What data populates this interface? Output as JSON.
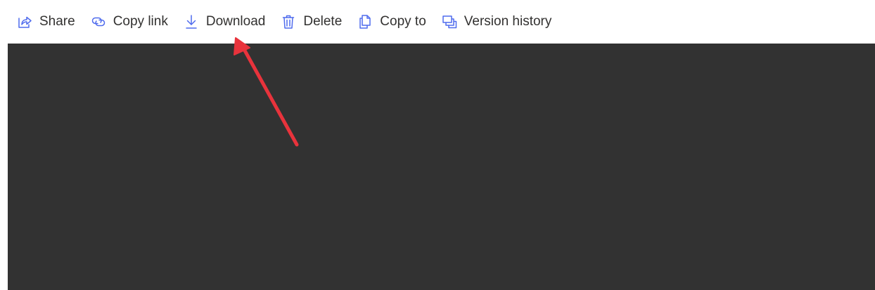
{
  "toolbar": {
    "items": [
      {
        "label": "Share",
        "icon": "share-icon"
      },
      {
        "label": "Copy link",
        "icon": "link-icon"
      },
      {
        "label": "Download",
        "icon": "download-icon"
      },
      {
        "label": "Delete",
        "icon": "trash-icon"
      },
      {
        "label": "Copy to",
        "icon": "copy-icon"
      },
      {
        "label": "Version history",
        "icon": "version-history-icon"
      }
    ]
  },
  "colors": {
    "icon_accent": "#4f6bed",
    "text": "#323130",
    "viewer_background": "#323232",
    "annotation_arrow": "#e8333c"
  }
}
